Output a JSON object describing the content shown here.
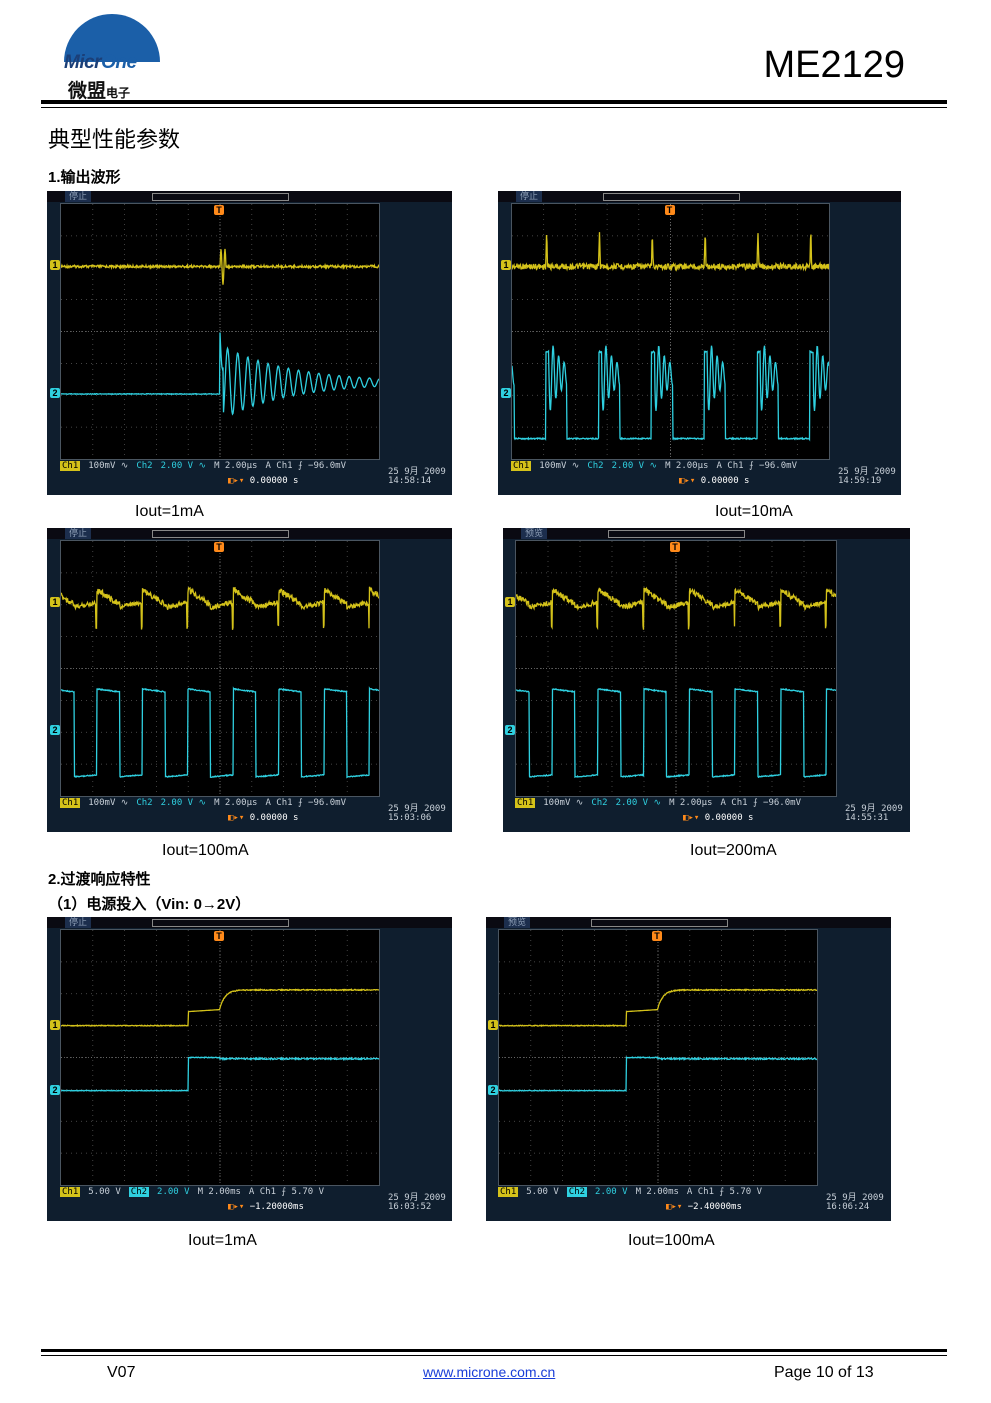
{
  "header": {
    "logo_text_a": "Micr",
    "logo_text_b": "One",
    "logo_cn": "微盟",
    "logo_cn_small": "电子",
    "model": "ME2129"
  },
  "section_title": "典型性能参数",
  "sub1": "1.输出波形",
  "sub2": "2.过渡响应特性",
  "sub2_1": "（1）电源投入（Vin: 0→2V）",
  "scopes": [
    {
      "state": "停止",
      "ch1": "Ch1",
      "ch1_scale": "100mV ∿",
      "ch2": "Ch2",
      "ch2_scale": "2.00 V ∿",
      "timebase": "M 2.00µs",
      "trig": "A  Ch1 ⨍ −96.0mV",
      "date": "25 9月 2009",
      "time": "14:58:14",
      "toffset": "0.00000 s",
      "caption": "Iout=1mA"
    },
    {
      "state": "停止",
      "ch1": "Ch1",
      "ch1_scale": "100mV ∿",
      "ch2": "Ch2",
      "ch2_scale": "2.00 V ∿",
      "timebase": "M 2.00µs",
      "trig": "A  Ch1 ⨍ −96.0mV",
      "date": "25 9月 2009",
      "time": "14:59:19",
      "toffset": "0.00000 s",
      "caption": "Iout=10mA"
    },
    {
      "state": "停止",
      "ch1": "Ch1",
      "ch1_scale": "100mV ∿",
      "ch2": "Ch2",
      "ch2_scale": "2.00 V ∿",
      "timebase": "M 2.00µs",
      "trig": "A  Ch1 ⨍ −96.0mV",
      "date": "25 9月 2009",
      "time": "15:03:06",
      "toffset": "0.00000 s",
      "caption": "Iout=100mA"
    },
    {
      "state": "预览",
      "ch1": "Ch1",
      "ch1_scale": "100mV ∿",
      "ch2": "Ch2",
      "ch2_scale": "2.00 V ∿",
      "timebase": "M 2.00µs",
      "trig": "A  Ch1 ⨍ −96.0mV",
      "date": "25 9月 2009",
      "time": "14:55:31",
      "toffset": "0.00000 s",
      "caption": "Iout=200mA"
    },
    {
      "state": "停止",
      "ch1": "Ch1",
      "ch1_scale": "5.00 V",
      "ch2": "Ch2",
      "ch2_scale": "2.00 V",
      "timebase": "M 2.00ms",
      "trig": "A  Ch1 ⨍  5.70 V",
      "date": "25 9月 2009",
      "time": "16:03:52",
      "toffset": "−1.20000ms",
      "caption": "Iout=1mA"
    },
    {
      "state": "预览",
      "ch1": "Ch1",
      "ch1_scale": "5.00 V",
      "ch2": "Ch2",
      "ch2_scale": "2.00 V",
      "timebase": "M 2.00ms",
      "trig": "A  Ch1 ⨍  5.70 V",
      "date": "25 9月 2009",
      "time": "16:06:24",
      "toffset": "−2.40000ms",
      "caption": "Iout=100mA"
    }
  ],
  "colors": {
    "ch1": "#d4c21a",
    "ch2": "#2fd0e0",
    "trigger": "#ff8a1a",
    "bezel": "#0f1e2e"
  },
  "footer": {
    "version": "V07",
    "url": "www.microne.com.cn",
    "page": "Page 10 of 13"
  }
}
